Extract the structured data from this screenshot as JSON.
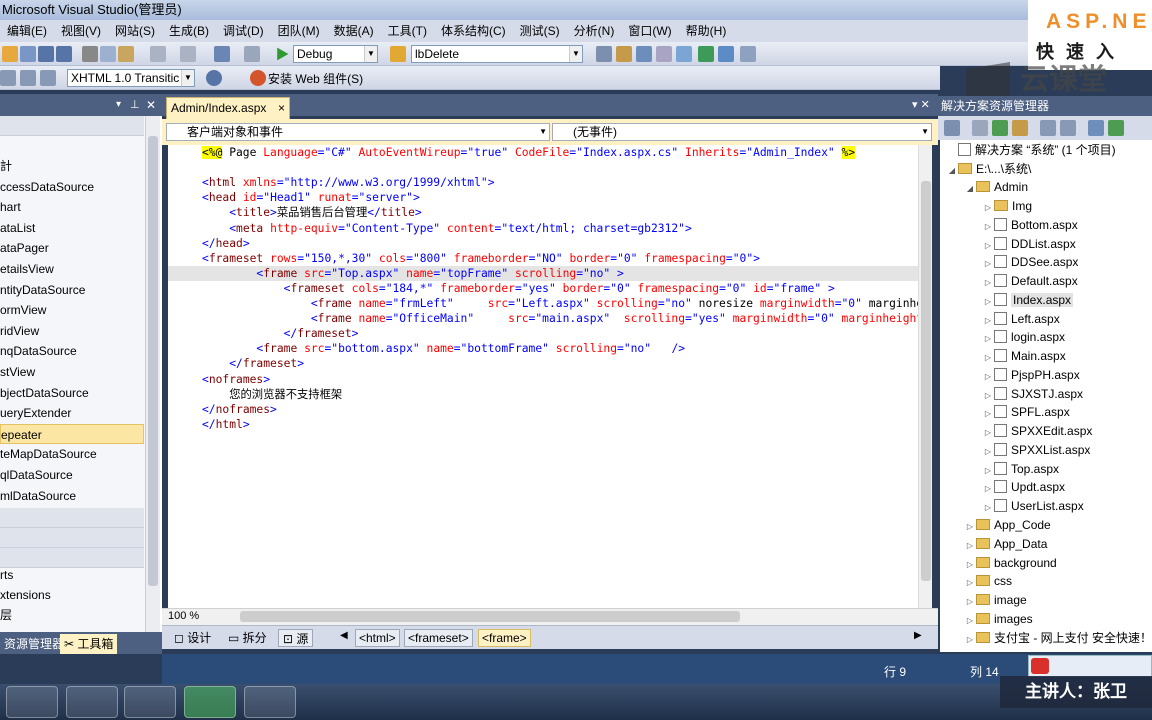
{
  "window": {
    "title": "Microsoft Visual Studio(管理员)"
  },
  "menu": [
    "编辑(E)",
    "视图(V)",
    "网站(S)",
    "生成(B)",
    "调试(D)",
    "团队(M)",
    "数据(A)",
    "工具(T)",
    "体系结构(C)",
    "测试(S)",
    "分析(N)",
    "窗口(W)",
    "帮助(H)"
  ],
  "toolbar": {
    "config": "Debug",
    "find": "lbDelete",
    "doctype": "XHTML 1.0 Transitic",
    "install_web": "安装 Web 组件(S)"
  },
  "logo": {
    "line1": "ASP.NE",
    "line2": "快速入"
  },
  "watermark": "云课堂",
  "toolbox": {
    "items": [
      "計",
      "ccessDataSource",
      "hart",
      "ataList",
      "ataPager",
      "etailsView",
      "ntityDataSource",
      "ormView",
      "ridView",
      "nqDataSource",
      "stView",
      "bjectDataSource",
      "ueryExtender",
      "epeater",
      "teMapDataSource",
      "qlDataSource",
      "mlDataSource"
    ],
    "selected_index": 13,
    "lower_items": [
      "rts",
      "xtensions",
      "层"
    ],
    "tab_solution": "资源管理器",
    "tab_toolbox": "工具箱"
  },
  "editor": {
    "tab": "Admin/Index.aspx",
    "close": "×",
    "nav_left": "客户端对象和事件",
    "nav_right": "(无事件)",
    "zoom": "100 %",
    "views": {
      "design": "设计",
      "split": "拆分",
      "source": "源"
    },
    "breadcrumbs": [
      "<html>",
      "<frameset>",
      "<frame>"
    ]
  },
  "code": [
    "<%@ Page Language=\"C#\" AutoEventWireup=\"true\" CodeFile=\"Index.aspx.cs\" Inherits=\"Admin_Index\" %>",
    "",
    "<html xmlns=\"http://www.w3.org/1999/xhtml\">",
    "<head id=\"Head1\" runat=\"server\">",
    "    <title>菜品销售后台管理</title>",
    "    <meta http-equiv=\"Content-Type\" content=\"text/html; charset=gb2312\">",
    "</head>",
    "<frameset rows=\"150,*,30\" cols=\"800\" frameborder=\"NO\" border=\"0\" framespacing=\"0\">",
    "        <frame src=\"Top.aspx\" name=\"topFrame\" scrolling=\"no\" >",
    "            <frameset cols=\"184,*\" frameborder=\"yes\" border=\"0\" framespacing=\"0\" id=\"frame\" >",
    "                <frame name=\"frmLeft\"     src=\"Left.aspx\" scrolling=\"no\" noresize marginwidth=\"0\" marginheigh",
    "                <frame name=\"OfficeMain\"     src=\"main.aspx\"  scrolling=\"yes\" marginwidth=\"0\" marginheight=\"0",
    "            </frameset>",
    "        <frame src=\"bottom.aspx\" name=\"bottomFrame\" scrolling=\"no\"   />",
    "    </frameset>",
    "<noframes>",
    "    您的浏览器不支持框架",
    "</noframes>",
    "</html>"
  ],
  "solution_explorer": {
    "title": "解决方案资源管理器",
    "solution": "解决方案 “系统” (1 个项目)",
    "project": "E:\\...\\系统\\",
    "admin": "Admin",
    "admin_children": [
      "Img",
      "Bottom.aspx",
      "DDList.aspx",
      "DDSee.aspx",
      "Default.aspx",
      "Index.aspx",
      "Left.aspx",
      "login.aspx",
      "Main.aspx",
      "PjspPH.aspx",
      "SJXSTJ.aspx",
      "SPFL.aspx",
      "SPXXEdit.aspx",
      "SPXXList.aspx",
      "Top.aspx",
      "Updt.aspx",
      "UserList.aspx"
    ],
    "selected": "Index.aspx",
    "folders": [
      "App_Code",
      "App_Data",
      "background",
      "css",
      "image",
      "images",
      "支付宝 - 网上支付 安全快速！"
    ]
  },
  "status": {
    "line": "行 9",
    "col": "列 14"
  },
  "speaker": "主讲人：张卫"
}
